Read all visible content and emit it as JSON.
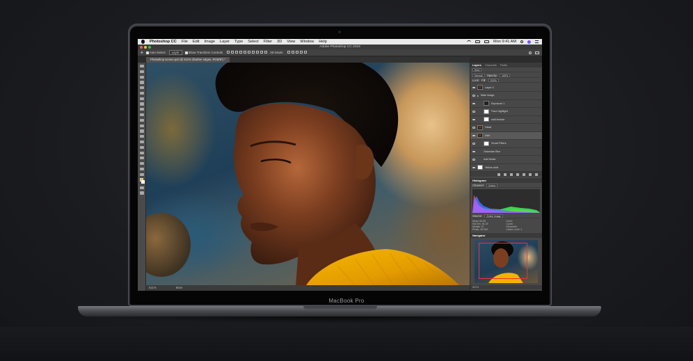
{
  "menubar": {
    "app_name": "Photoshop CC",
    "items": [
      "File",
      "Edit",
      "Image",
      "Layer",
      "Type",
      "Select",
      "Filter",
      "3D",
      "View",
      "Window",
      "Help"
    ],
    "clock": "Mon 9:41 AM"
  },
  "window": {
    "title": "Adobe Photoshop CC 2019"
  },
  "options": {
    "auto_select_label": "Auto-Select:",
    "auto_select_value": "Layer",
    "show_transform_label": "Show Transform Controls",
    "mode_3d_label": "3D Mode:"
  },
  "document": {
    "tab_label": "Photoshop screen.psd @ 521% (feather edges, RGB/8*) *",
    "zoom": "521%",
    "status_text": "More"
  },
  "layers_panel": {
    "tabs": [
      "Layers",
      "Channels",
      "Paths"
    ],
    "kind_label": "Kind",
    "blend_mode": "Normal",
    "opacity_label": "Opacity:",
    "opacity_value": "100%",
    "lock_label": "Lock:",
    "fill_label": "Fill:",
    "fill_value": "100%",
    "layers": [
      {
        "name": "Layer 0"
      },
      {
        "name": "Main image"
      },
      {
        "name": "Exposure 1"
      },
      {
        "name": "Face highlight"
      },
      {
        "name": "wall texture"
      },
      {
        "name": "Head"
      },
      {
        "name": "Hair"
      },
      {
        "name": "Smart Filters"
      },
      {
        "name": "Gaussian Blur"
      },
      {
        "name": "Add Noise"
      },
      {
        "name": "Yellow shirt"
      }
    ]
  },
  "histogram": {
    "title": "Histogram",
    "channel_label": "Channel:",
    "channel_value": "Colors",
    "source_label": "Source:",
    "source_value": "Entire Image",
    "stats": [
      {
        "label": "Mean:",
        "value": "84.95"
      },
      {
        "label": "Level:",
        "value": ""
      },
      {
        "label": "Std Dev:",
        "value": "81.28"
      },
      {
        "label": "Count:",
        "value": ""
      },
      {
        "label": "Median:",
        "value": "67"
      },
      {
        "label": "Percentile:",
        "value": ""
      },
      {
        "label": "Pixels:",
        "value": "267300"
      },
      {
        "label": "Cache Level:",
        "value": "4"
      }
    ]
  },
  "navigator": {
    "title": "Navigator",
    "zoom": "521%"
  },
  "laptop": {
    "label": "MacBook Pro"
  }
}
